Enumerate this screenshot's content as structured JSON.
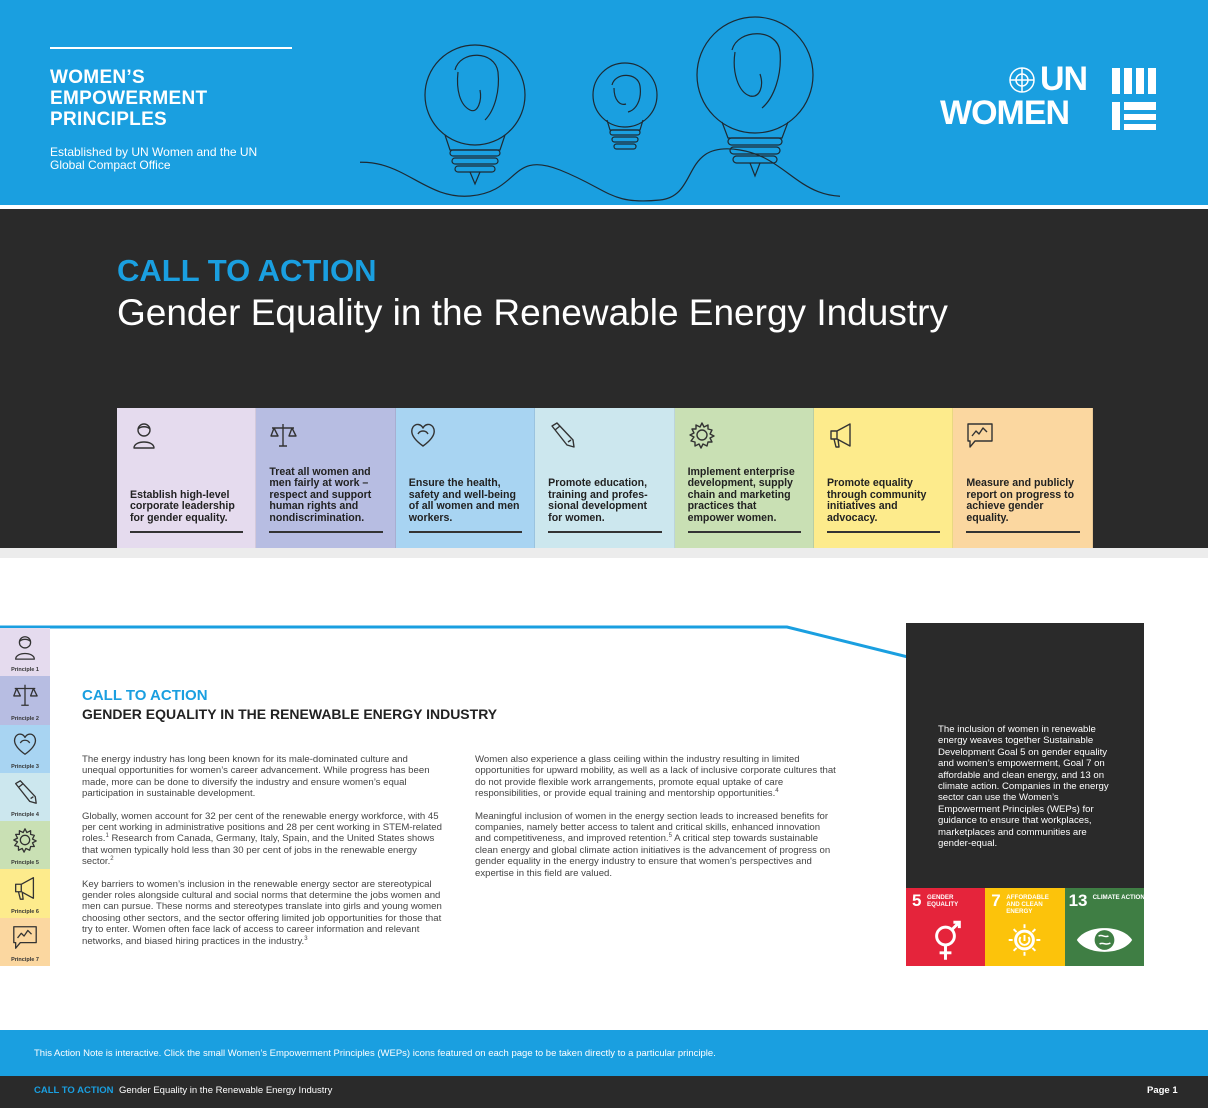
{
  "header": {
    "title_lines": [
      "WOMEN’S",
      "EMPOWERMENT",
      "PRINCIPLES"
    ],
    "subtitle": "Established by UN Women and the UN Global Compact Office",
    "logo_top": "UN",
    "logo_bottom": "WOMEN"
  },
  "hero": {
    "cta": "CALL TO ACTION",
    "title": "Gender Equality in the Renewable Energy Industry"
  },
  "principles": [
    {
      "text": "Establish high-level corporate leadership for gender equality.",
      "color": "#e5dbee",
      "icon": "person-icon"
    },
    {
      "text": "Treat all women and men fairly at work – respect and support human rights and nondiscrimination.",
      "color": "#b7bde2",
      "icon": "scales-icon"
    },
    {
      "text": "Ensure the health, safety and well-being of all women and men workers.",
      "color": "#a8d4f2",
      "icon": "heart-icon"
    },
    {
      "text": "Promote education, training and profes-sional development for women.",
      "color": "#cce7ee",
      "icon": "pencil-icon"
    },
    {
      "text": "Implement enterprise development, supply chain and marketing practices that empower women.",
      "color": "#c9e0b4",
      "icon": "gear-icon"
    },
    {
      "text": "Promote equality through community initiatives and advocacy.",
      "color": "#fdeb8c",
      "icon": "megaphone-icon"
    },
    {
      "text": "Measure and publicly report on progress to achieve gender equality.",
      "color": "#fbd7a0",
      "icon": "chart-bubble-icon"
    }
  ],
  "side_tabs": [
    {
      "label": "Principle 1",
      "color": "#e5dbee"
    },
    {
      "label": "Principle 2",
      "color": "#b7bde2"
    },
    {
      "label": "Principle 3",
      "color": "#a8d4f2"
    },
    {
      "label": "Principle 4",
      "color": "#cce7ee"
    },
    {
      "label": "Principle 5",
      "color": "#c9e0b4"
    },
    {
      "label": "Principle 6",
      "color": "#fdeb8c"
    },
    {
      "label": "Principle 7",
      "color": "#fbd7a0"
    }
  ],
  "body": {
    "cta": "CALL TO ACTION",
    "title": "GENDER EQUALITY IN THE RENEWABLE ENERGY INDUSTRY",
    "col1": [
      "The energy industry has long been known for its male-dominated culture and unequal opportunities for women’s career advancement. While progress has been made, more can be done to diversify the industry and ensure women’s equal participation in sustainable development.",
      "Globally, women account for 32 per cent of the renewable energy workforce, with 45 per cent working in administrative positions and 28 per cent working in STEM-related roles.",
      " Research from Canada, Germany, Italy, Spain, and the United States shows that women typically hold less than 30 per cent of jobs in the renewable energy sector.",
      "Key barriers to women’s inclusion in the renewable energy sector are stereotypical gender roles alongside cultural and social norms that determine the jobs women and men can pursue. These norms and stereotypes translate into girls and young women choosing other sectors, and the sector offering limited job opportunities for those that try to enter. Women often face lack of access to career information and relevant networks, and biased hiring practices in the industry."
    ],
    "col2": [
      "Women also experience a glass ceiling within the industry resulting in limited opportunities for upward mobility, as well as a lack of inclusive corporate cultures that do not provide flexible work arrangements, promote equal uptake of care responsibilities, or provide equal training and mentorship opportunities.",
      "Meaningful inclusion of women in the energy section leads to increased benefits for companies, namely better access to talent and critical skills, enhanced innovation and competitiveness, and improved retention.",
      " A critical step towards sustainable clean energy and global climate action initiatives is the advancement of progress on gender equality in the energy industry to ensure that women’s perspectives and expertise in this field are valued."
    ],
    "footnotes": [
      "1",
      "2",
      "3",
      "4",
      "5"
    ]
  },
  "callout": {
    "text": "The inclusion of women in renewable energy weaves together Sustainable Development Goal 5 on gender equality and women’s empowerment, Goal 7 on affordable and clean energy, and 13 on climate action. Companies in the energy sector can use the Women’s Empowerment Principles (WEPs) for guidance to ensure that workplaces, marketplaces and communities are gender-equal."
  },
  "sdgs": [
    {
      "num": "5",
      "label": "GENDER EQUALITY",
      "color": "#e5243b",
      "icon": "gender-equality-icon"
    },
    {
      "num": "7",
      "label": "AFFORDABLE AND CLEAN ENERGY",
      "color": "#fcc30b",
      "icon": "sun-power-icon"
    },
    {
      "num": "13",
      "label": "CLIMATE ACTION",
      "color": "#3f7e44",
      "icon": "earth-eye-icon"
    }
  ],
  "footer": {
    "note": "This Action Note is interactive. Click the small Women’s Empowerment Principles (WEPs) icons featured on each page to be taken directly to a particular principle.",
    "cta": "CALL TO ACTION",
    "title": "Gender Equality in the Renewable Energy Industry",
    "page": "Page 1"
  },
  "colors": {
    "accent": "#1a9fe0",
    "dark": "#2a2a2a"
  }
}
